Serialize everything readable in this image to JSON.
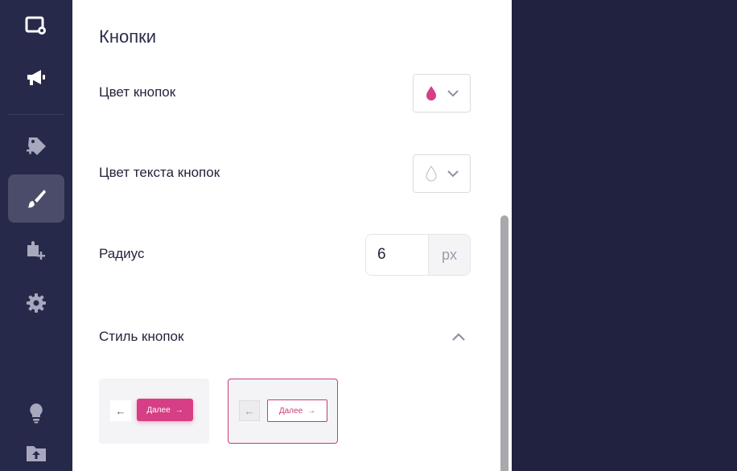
{
  "sidebar": {
    "icons": [
      "window-settings-icon",
      "megaphone-icon",
      "tag-add-icon",
      "brush-icon",
      "plugin-add-icon",
      "gear-icon",
      "lightbulb-icon",
      "folder-upload-icon"
    ],
    "active": "brush-icon"
  },
  "panel": {
    "title": "Кнопки",
    "button_color": {
      "label": "Цвет кнопок",
      "value": "#d63f85"
    },
    "button_text_color": {
      "label": "Цвет текста кнопок",
      "value": "#ffffff"
    },
    "radius": {
      "label": "Радиус",
      "value": "6",
      "unit": "px"
    },
    "button_style": {
      "label": "Стиль кнопок",
      "expanded": true,
      "options": [
        {
          "back": "←",
          "next": "Далее",
          "arrow": "→",
          "variant": "filled"
        },
        {
          "back": "←",
          "next": "Далее",
          "arrow": "→",
          "variant": "outlined",
          "selected": true
        }
      ]
    }
  },
  "colors": {
    "sidebar_bg": "#27294a",
    "background": "#20223f",
    "accent": "#d63f85"
  }
}
